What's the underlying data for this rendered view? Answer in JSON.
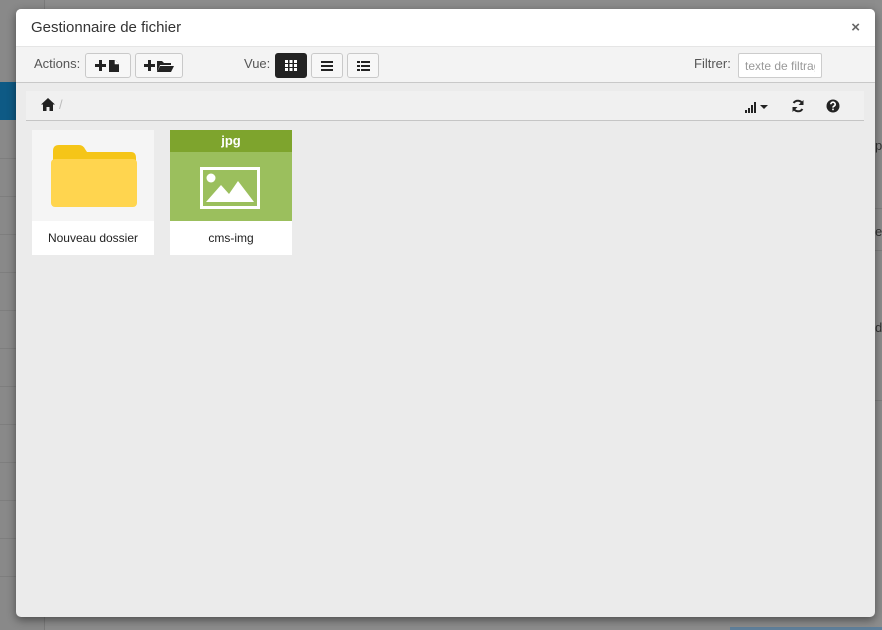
{
  "dialog": {
    "title": "Gestionnaire de fichier",
    "close_label": "×"
  },
  "toolbar": {
    "actions_label": "Actions:",
    "view_label": "Vue:",
    "filter_label": "Filtrer:",
    "filter_placeholder": "texte de filtrage",
    "active_view": "grid"
  },
  "breadcrumb": {
    "separator": "/"
  },
  "items": [
    {
      "name": "Nouveau dossier",
      "kind": "folder",
      "icon": "folder-icon"
    },
    {
      "name": "cms-img",
      "kind": "file",
      "extension": "jpg",
      "icon": "image-icon"
    }
  ],
  "colors": {
    "folder": "#ffd54f",
    "file_band": "#7ea42d",
    "file_thumb": "#9bbf5d",
    "active_button": "#222222"
  },
  "background_fragments": [
    "pi",
    "e",
    "de"
  ]
}
